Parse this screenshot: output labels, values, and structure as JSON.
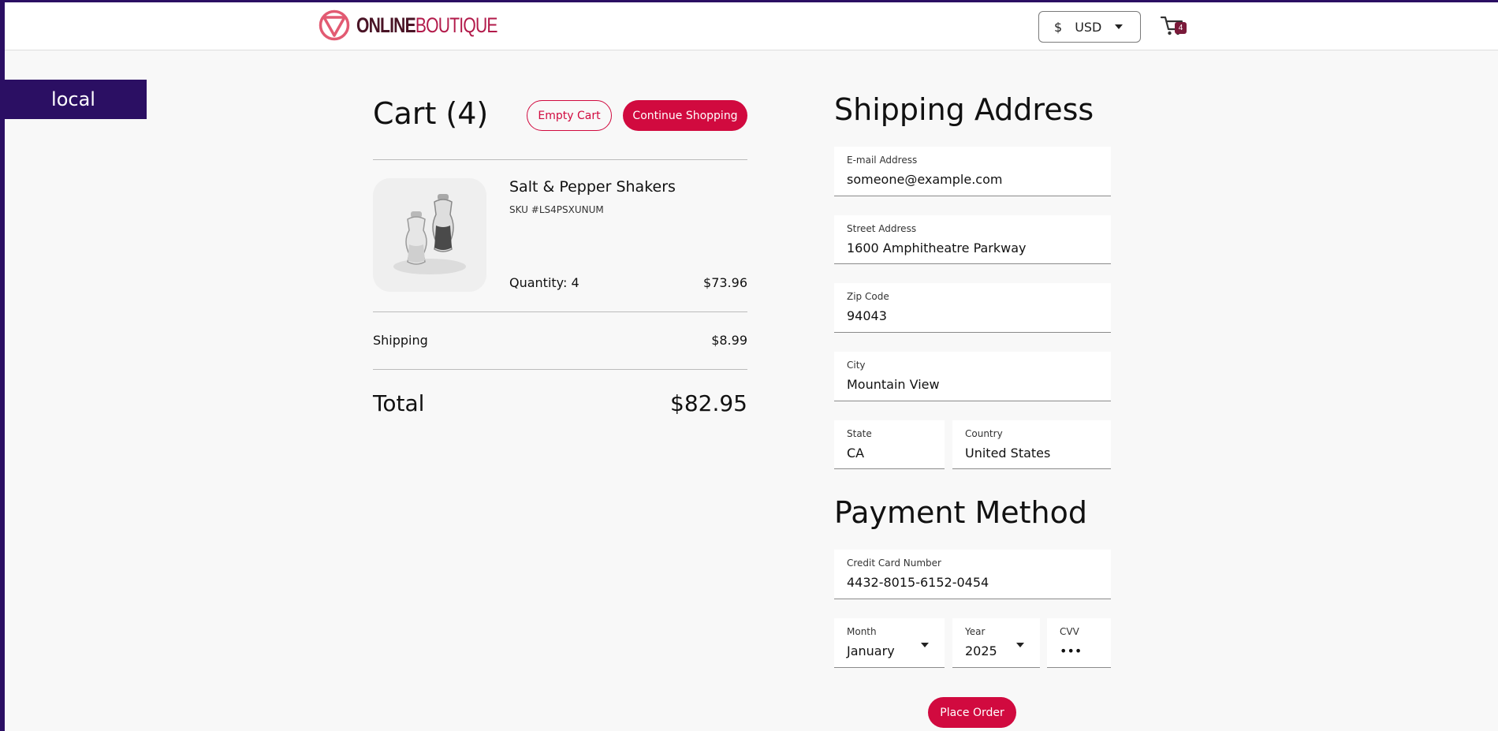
{
  "header": {
    "logo_bold": "ONLINE",
    "logo_light": "BOUTIQUE",
    "currency_symbol": "$",
    "currency_code": "USD",
    "cart_count": "4"
  },
  "env_badge": "local",
  "cart": {
    "title": "Cart (4)",
    "empty_button": "Empty Cart",
    "continue_button": "Continue Shopping",
    "items": [
      {
        "name": "Salt & Pepper Shakers",
        "sku": "SKU #LS4PSXUNUM",
        "quantity": "Quantity: 4",
        "price": "$73.96"
      }
    ],
    "shipping_label": "Shipping",
    "shipping_price": "$8.99",
    "total_label": "Total",
    "total_price": "$82.95"
  },
  "shipping": {
    "title": "Shipping Address",
    "email_label": "E-mail Address",
    "email": "someone@example.com",
    "street_label": "Street Address",
    "street": "1600 Amphitheatre Parkway",
    "zip_label": "Zip Code",
    "zip": "94043",
    "city_label": "City",
    "city": "Mountain View",
    "state_label": "State",
    "state": "CA",
    "country_label": "Country",
    "country": "United States"
  },
  "payment": {
    "title": "Payment Method",
    "card_label": "Credit Card Number",
    "card": "4432-8015-6152-0454",
    "month_label": "Month",
    "month": "January",
    "year_label": "Year",
    "year": "2025",
    "cvv_label": "CVV",
    "cvv": "•••",
    "place_order": "Place Order"
  },
  "colors": {
    "accent": "#d10a3f",
    "env_badge": "#2b0f63",
    "background": "#f8f8f8"
  }
}
